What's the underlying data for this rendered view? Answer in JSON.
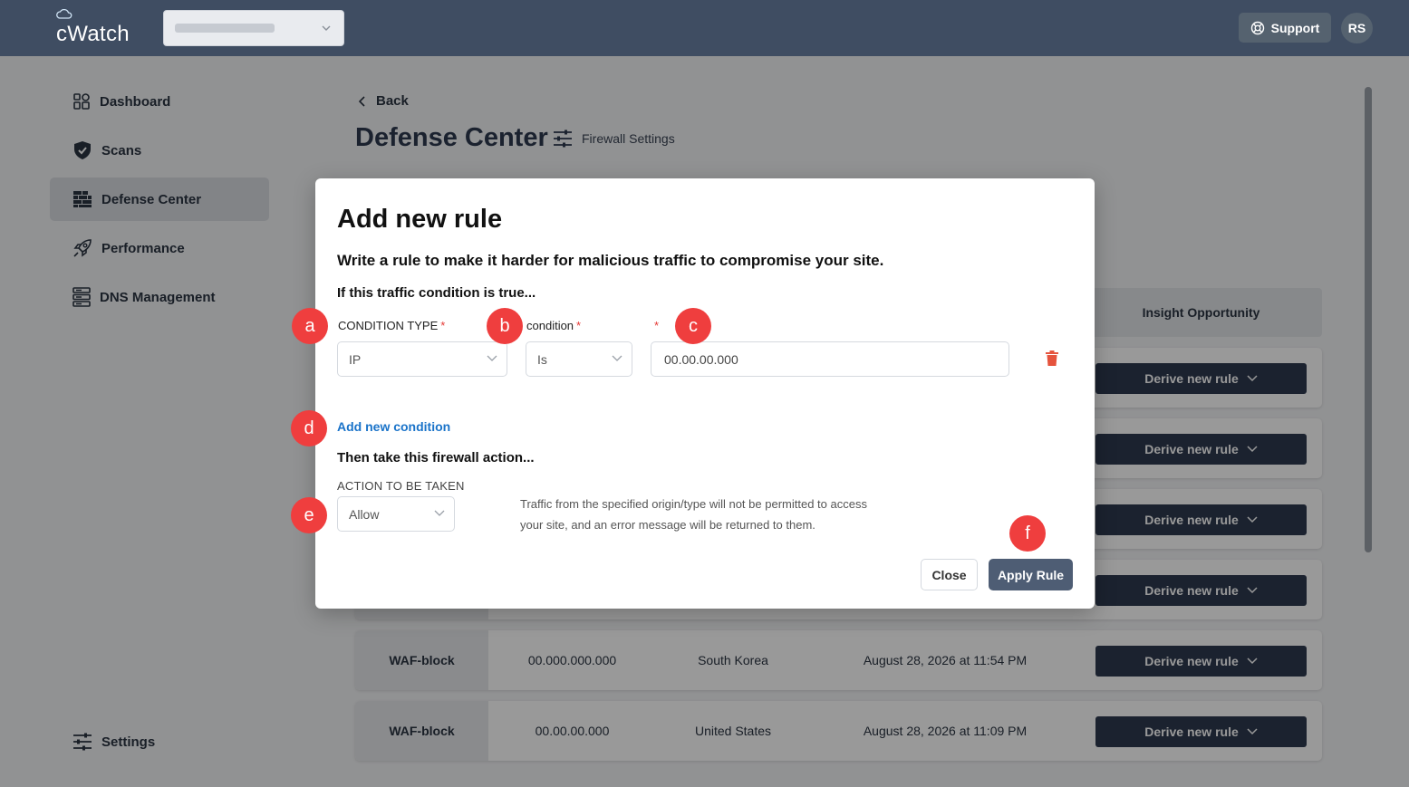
{
  "app": {
    "logo_text": "cWatch",
    "site_selector_value": "",
    "support_label": "Support",
    "user_initials": "RS"
  },
  "sidebar": {
    "items": [
      {
        "label": "Dashboard",
        "icon": "dashboard-icon"
      },
      {
        "label": "Scans",
        "icon": "shield-icon"
      },
      {
        "label": "Defense Center",
        "icon": "brick-wall-icon",
        "active": true
      },
      {
        "label": "Performance",
        "icon": "rocket-icon"
      },
      {
        "label": "DNS Management",
        "icon": "server-icon"
      }
    ],
    "settings_label": "Settings"
  },
  "main": {
    "back_label": "Back",
    "title": "Defense Center",
    "firewall_settings_label": "Firewall Settings",
    "insight_column_header": "Insight Opportunity",
    "derive_label": "Derive new rule",
    "rows": [
      {
        "type": "WAF-block",
        "ip": "00.000.000.000",
        "country": "South Korea",
        "date": "August 28, 2026 at 11:54 PM"
      },
      {
        "type": "WAF-block",
        "ip": "00.00.00.000",
        "country": "United States",
        "date": "August 28, 2026 at 11:09 PM"
      }
    ]
  },
  "modal": {
    "title": "Add new rule",
    "subtitle": "Write a rule to make it harder for malicious traffic to compromise your site.",
    "condition_heading": "If this traffic condition is true...",
    "condition_type_label": "CONDITION TYPE",
    "condition_label": "condition",
    "required_mark": "*",
    "condition_type_value": "IP",
    "condition_value": "Is",
    "ip_input_value": "00.00.00.000",
    "add_condition_label": "Add new condition",
    "action_heading": "Then take this firewall action...",
    "action_label": "ACTION TO BE TAKEN",
    "action_value": "Allow",
    "help_text": "Traffic from the specified origin/type will not be permitted to access your site, and an error message will be returned to them.",
    "close_label": "Close",
    "apply_label": "Apply Rule"
  },
  "markers": [
    "a",
    "b",
    "c",
    "d",
    "e",
    "f"
  ],
  "colors": {
    "topbar": "#3f4d62",
    "primary_button": "#2e3a4f",
    "apply_button": "#4e5d74",
    "link": "#1a73c9",
    "marker": "#ef3e3e",
    "trash": "#e5533d"
  }
}
